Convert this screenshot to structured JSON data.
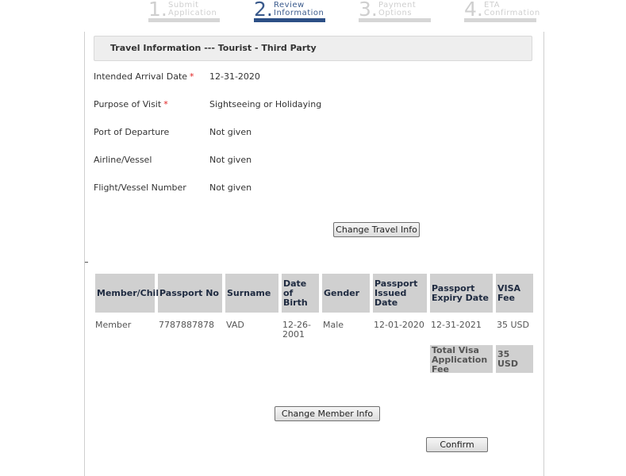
{
  "steps": [
    {
      "num": "1.",
      "line1": "Submit",
      "line2": "Application",
      "active": false
    },
    {
      "num": "2.",
      "line1": "Review",
      "line2": "Information",
      "active": true
    },
    {
      "num": "3.",
      "line1": "Payment",
      "line2": "Options",
      "active": false
    },
    {
      "num": "4.",
      "line1": "ETA",
      "line2": "Confirmation",
      "active": false
    }
  ],
  "section_title": "Travel Information --- Tourist - Third Party",
  "fields": [
    {
      "label": "Intended Arrival Date",
      "required": "*",
      "value": "12-31-2020"
    },
    {
      "label": "Purpose of Visit",
      "required": "*",
      "value": "Sightseeing or Holidaying"
    },
    {
      "label": "Port of Departure",
      "required": "",
      "value": "Not given"
    },
    {
      "label": "Airline/Vessel",
      "required": "",
      "value": "Not given"
    },
    {
      "label": "Flight/Vessel Number",
      "required": "",
      "value": "Not given"
    }
  ],
  "buttons": {
    "change_travel": "Change Travel Info",
    "change_member": "Change Member Info",
    "confirm": "Confirm"
  },
  "table": {
    "headers": [
      "Member/Child",
      "Passport No",
      "Surname",
      "Date of Birth",
      "Gender",
      "Passport Issued Date",
      "Passport Expiry Date",
      "VISA Fee"
    ],
    "rows": [
      [
        "Member",
        "7787887878",
        "VAD",
        "12-26-2001",
        "Male",
        "12-01-2020",
        "12-31-2021",
        "35 USD"
      ]
    ],
    "total_label": "Total Visa Application Fee",
    "total_value": "35 USD"
  }
}
